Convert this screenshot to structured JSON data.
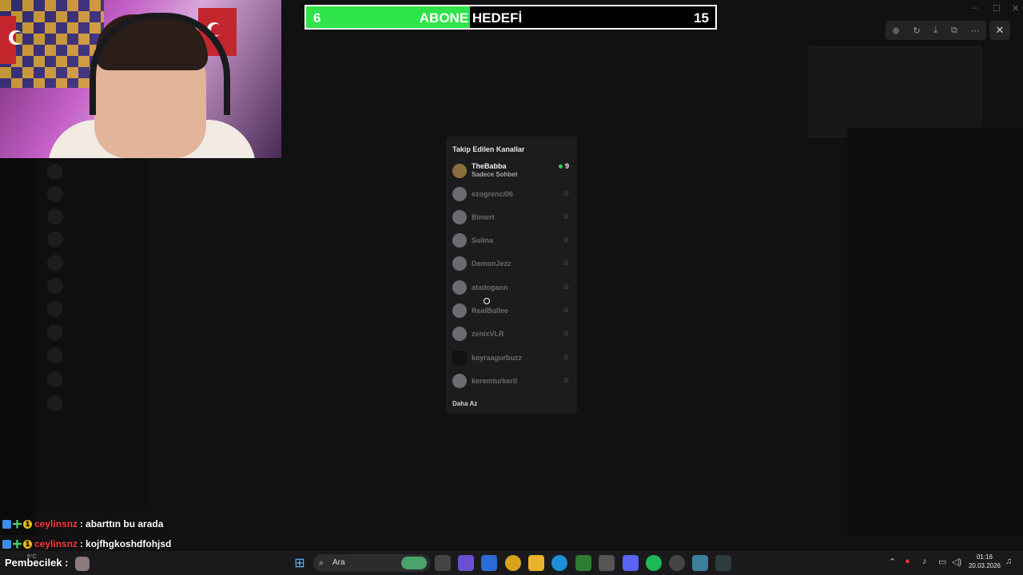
{
  "goal": {
    "start": "6",
    "title": "ABONE HEDEFİ",
    "end": "15",
    "progress": 0.4
  },
  "popup": {
    "header": "Takip Edilen Kanallar",
    "live_channel": {
      "name": "TheBabba",
      "category": "Sadece Sohbet",
      "viewers": "9"
    },
    "offline_channels": [
      "ezogrenci06",
      "Bimert",
      "Sulina",
      "DemonJezz",
      "atadogann",
      "RealBullee",
      "zenixVLR",
      "kayraagurbuzz",
      "keremturkeril"
    ],
    "footer": "Daha Az"
  },
  "chat": [
    {
      "user": "ceylinsnz",
      "sep": ":",
      "message": "abarttın bu arada"
    },
    {
      "user": "ceylinsnz",
      "sep": ":",
      "message": "kojfhgkoshdfohjsd"
    }
  ],
  "overlay_label": "Pembecilek :",
  "taskbar": {
    "search_placeholder": "Ara",
    "time": "01:16",
    "date": "20.03.2026",
    "weather": "6°C"
  },
  "window_controls": {
    "minimize": "–",
    "maximize": "☐",
    "close": "✕"
  },
  "viewer_toolbar": [
    "zoom-in-icon",
    "rotate-icon",
    "download-icon",
    "open-external-icon",
    "more-icon"
  ],
  "icons": {
    "windows_start": "start-icon",
    "search": "search-icon"
  },
  "colors": {
    "goal_fill": "#2fe34a",
    "chat_user": "#ff3a3a",
    "live_dot": "#2fd14a"
  }
}
